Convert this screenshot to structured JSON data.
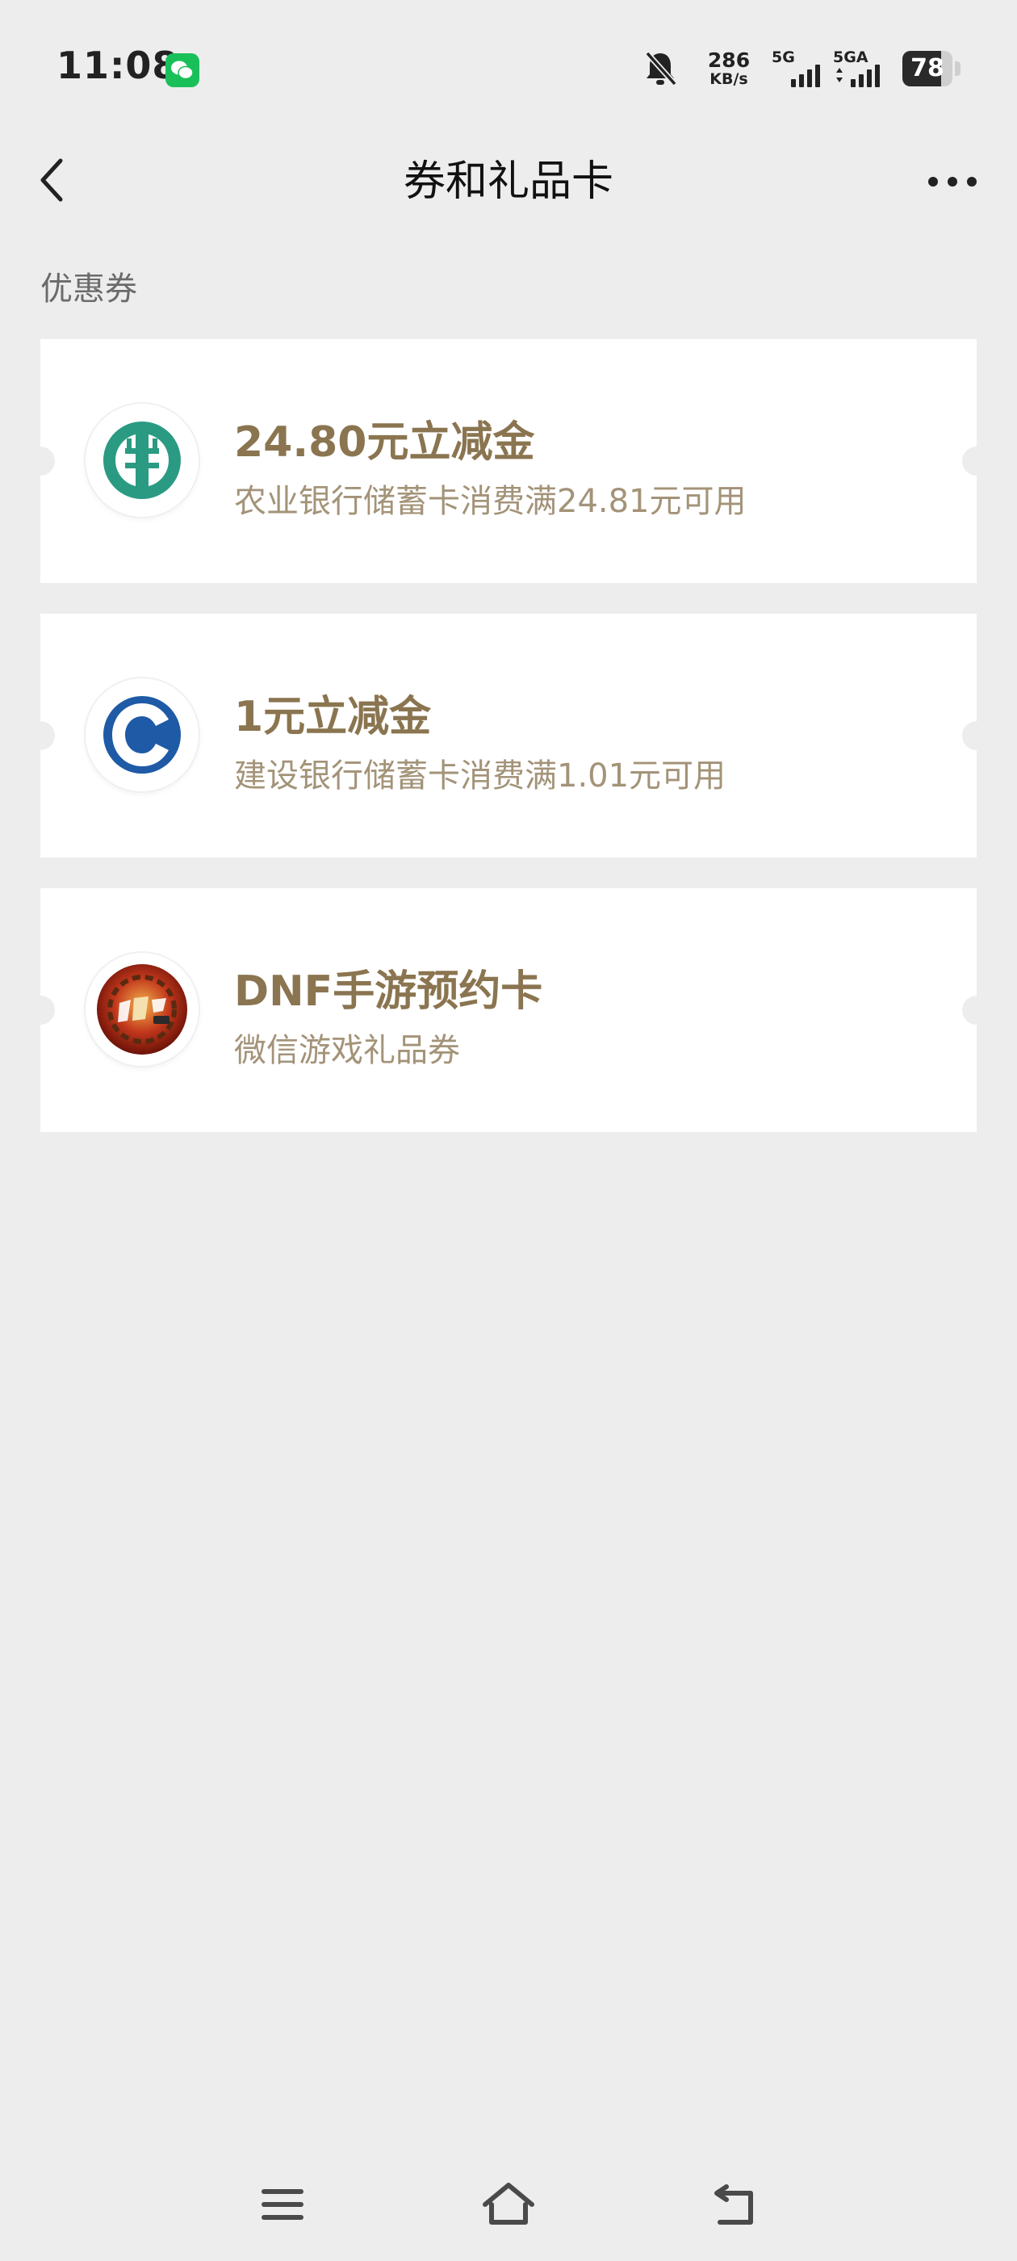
{
  "status_bar": {
    "time": "11:08",
    "app_badge_icon": "wechat-icon",
    "mute_icon": "bell-off-icon",
    "net_speed_value": "286",
    "net_speed_unit": "KB/s",
    "signal1_label": "5G",
    "signal2_label": "5GA",
    "battery_level": "78",
    "battery_fraction": 0.78
  },
  "nav": {
    "back_icon": "chevron-left-icon",
    "title": "券和礼品卡",
    "more_icon": "more-horizontal-icon"
  },
  "section": {
    "title": "优惠券"
  },
  "coupons": [
    {
      "logo_icon": "abc-bank-logo",
      "title": "24.80元立减金",
      "subtitle": "农业银行储蓄卡消费满24.81元可用"
    },
    {
      "logo_icon": "ccb-bank-logo",
      "title": "1元立减金",
      "subtitle": "建设银行储蓄卡消费满1.01元可用"
    },
    {
      "logo_icon": "dnf-game-logo",
      "title": "DNF手游预约卡",
      "subtitle": "微信游戏礼品券"
    }
  ],
  "system_nav": {
    "menu_icon": "menu-icon",
    "home_icon": "home-icon",
    "back_icon": "back-arrow-icon"
  },
  "colors": {
    "background": "#ededed",
    "card": "#ffffff",
    "coupon_title": "#8a7550",
    "coupon_subtitle": "#a39378",
    "section_title": "#6b6b6b",
    "abc_green": "#2a9b82",
    "ccb_blue": "#1f5aa6",
    "wechat_green": "#19c05a"
  }
}
